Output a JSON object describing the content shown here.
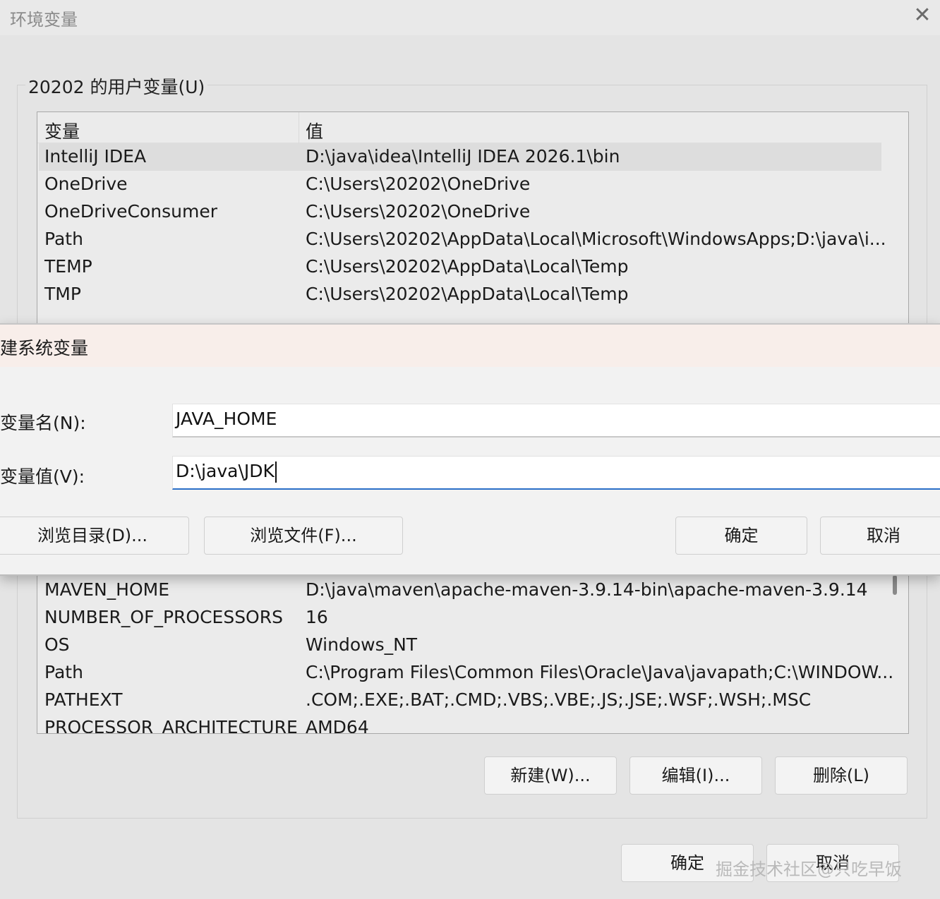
{
  "env_window": {
    "title": "环境变量",
    "close_glyph": "✕",
    "user_group_label": "20202 的用户变量(U)",
    "columns": {
      "name": "变量",
      "value": "值"
    },
    "user_vars": [
      {
        "name": "IntelliJ IDEA",
        "value": "D:\\java\\idea\\IntelliJ IDEA 2026.1\\bin"
      },
      {
        "name": "OneDrive",
        "value": "C:\\Users\\20202\\OneDrive"
      },
      {
        "name": "OneDriveConsumer",
        "value": "C:\\Users\\20202\\OneDrive"
      },
      {
        "name": "Path",
        "value": "C:\\Users\\20202\\AppData\\Local\\Microsoft\\WindowsApps;D:\\java\\i..."
      },
      {
        "name": "TEMP",
        "value": "C:\\Users\\20202\\AppData\\Local\\Temp"
      },
      {
        "name": "TMP",
        "value": "C:\\Users\\20202\\AppData\\Local\\Temp"
      }
    ],
    "system_vars": [
      {
        "name": "MAVEN_HOME",
        "value": "D:\\java\\maven\\apache-maven-3.9.14-bin\\apache-maven-3.9.14"
      },
      {
        "name": "NUMBER_OF_PROCESSORS",
        "value": "16"
      },
      {
        "name": "OS",
        "value": "Windows_NT"
      },
      {
        "name": "Path",
        "value": "C:\\Program Files\\Common Files\\Oracle\\Java\\javapath;C:\\WINDOW..."
      },
      {
        "name": "PATHEXT",
        "value": ".COM;.EXE;.BAT;.CMD;.VBS;.VBE;.JS;.JSE;.WSF;.WSH;.MSC"
      },
      {
        "name": "PROCESSOR_ARCHITECTURE",
        "value": "AMD64"
      }
    ],
    "system_buttons": {
      "new": "新建(W)...",
      "edit": "编辑(I)...",
      "delete": "删除(L)"
    },
    "bottom_buttons": {
      "ok": "确定",
      "cancel": "取消"
    }
  },
  "new_sys_var_dialog": {
    "title": "建系统变量",
    "name_label": "变量名(N):",
    "value_label": "变量值(V):",
    "name_value": "JAVA_HOME",
    "value_value": "D:\\java\\JDK",
    "buttons": {
      "browse_dir": "浏览目录(D)...",
      "browse_file": "浏览文件(F)...",
      "ok": "确定",
      "cancel": "取消"
    }
  },
  "watermark": "掘金技术社区@只吃早饭"
}
